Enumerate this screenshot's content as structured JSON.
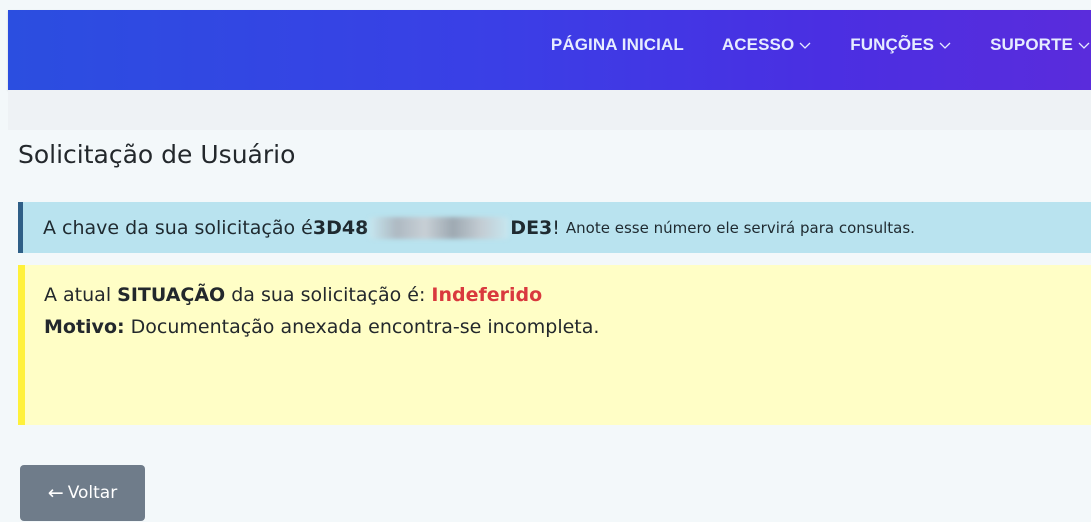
{
  "nav": {
    "items": [
      {
        "label": "PÁGINA INICIAL",
        "dropdown": false
      },
      {
        "label": "ACESSO",
        "dropdown": true
      },
      {
        "label": "FUNÇÕES",
        "dropdown": true
      },
      {
        "label": "SUPORTE",
        "dropdown": true
      }
    ]
  },
  "page": {
    "title": "Solicitação de Usuário"
  },
  "info_alert": {
    "prefix": "A chave da sua solicitação é ",
    "key_start": "3D48",
    "key_end": "DE3",
    "exclaim": "!",
    "note": "Anote esse número ele servirá para consultas."
  },
  "status_alert": {
    "prefix": "A atual ",
    "status_word": "SITUAÇÃO",
    "middle": " da sua solicitação é: ",
    "status_value": "Indeferido",
    "reason_label": "Motivo:",
    "reason_text": " Documentação anexada encontra-se incompleta."
  },
  "actions": {
    "back_label": "Voltar"
  },
  "colors": {
    "navbar_start": "#2b4ee0",
    "navbar_end": "#5a2cdc",
    "status_rejected": "#d9393e",
    "back_button": "#6f7c8a"
  }
}
